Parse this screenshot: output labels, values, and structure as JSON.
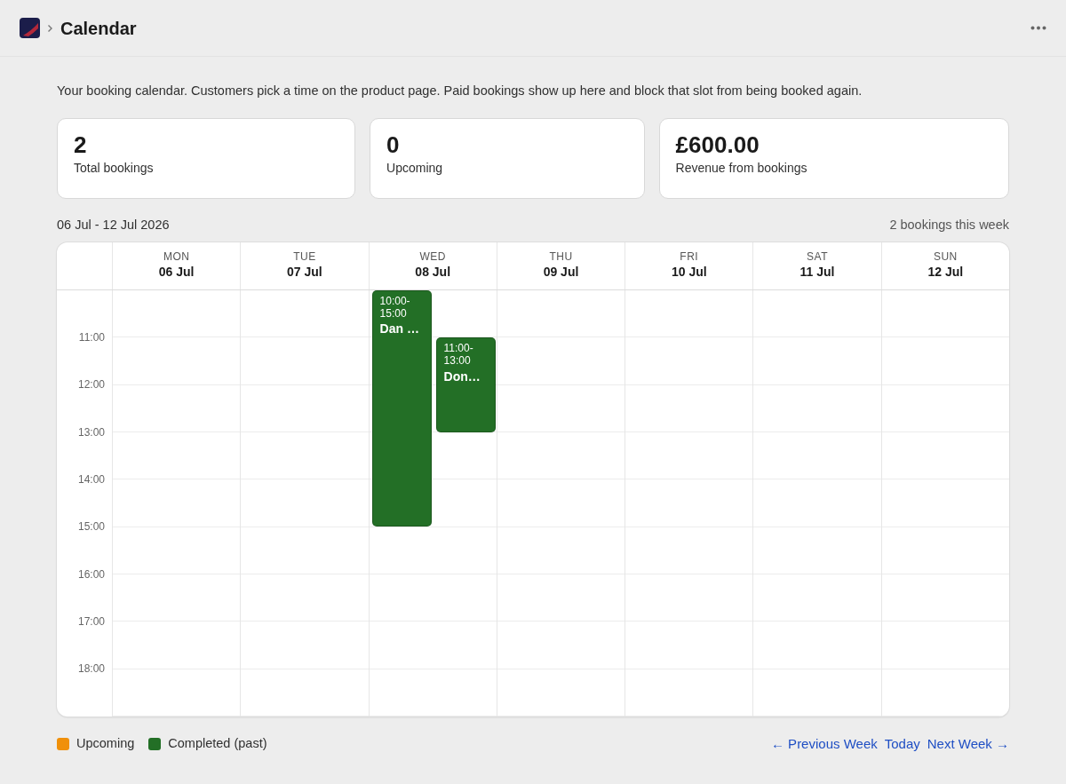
{
  "header": {
    "title": "Calendar"
  },
  "description": "Your booking calendar. Customers pick a time on the product page. Paid bookings show up here and block that slot from being booked again.",
  "stats": [
    {
      "value": "2",
      "label": "Total bookings"
    },
    {
      "value": "0",
      "label": "Upcoming"
    },
    {
      "value": "£600.00",
      "label": "Revenue from bookings"
    }
  ],
  "week": {
    "range": "06 Jul - 12 Jul 2026",
    "summary": "2 bookings this week"
  },
  "time_labels": [
    "11:00",
    "12:00",
    "13:00",
    "14:00",
    "15:00",
    "16:00",
    "17:00",
    "18:00"
  ],
  "days": [
    {
      "weekday": "MON",
      "date": "06 Jul"
    },
    {
      "weekday": "TUE",
      "date": "07 Jul"
    },
    {
      "weekday": "WED",
      "date": "08 Jul",
      "events": [
        {
          "time": "10:00-15:00",
          "name": "Dan …",
          "kind": "completed"
        },
        {
          "time": "11:00-13:00",
          "name": "Don…",
          "kind": "completed"
        }
      ]
    },
    {
      "weekday": "THU",
      "date": "09 Jul"
    },
    {
      "weekday": "FRI",
      "date": "10 Jul"
    },
    {
      "weekday": "SAT",
      "date": "11 Jul"
    },
    {
      "weekday": "SUN",
      "date": "12 Jul"
    }
  ],
  "legend": [
    {
      "kind": "upcoming",
      "label": "Upcoming",
      "color": "#f0900a"
    },
    {
      "kind": "completed",
      "label": "Completed (past)",
      "color": "#236f26"
    }
  ],
  "nav": [
    {
      "label": "← Previous Week"
    },
    {
      "label": "Today"
    },
    {
      "label": "Next Week →"
    }
  ]
}
